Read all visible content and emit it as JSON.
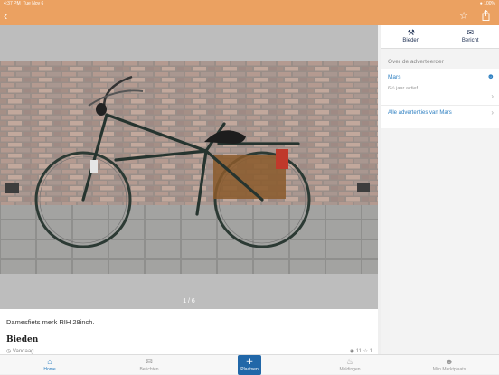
{
  "status": {
    "time": "4:37 PM",
    "date": "Tue Nov 6",
    "battery": "100%"
  },
  "nav": {
    "back_icon": "back-chevron-icon",
    "favorite_icon": "star-icon",
    "share_icon": "share-icon"
  },
  "listing": {
    "photo_counter": "1 / 6",
    "description": "Damesfiets merk RIH 28inch.",
    "bid_heading": "Bieden",
    "date_label": "Vandaag",
    "views": "11",
    "favorites": "1"
  },
  "actions": [
    {
      "label": "Bieden",
      "icon": "auction-hammer-icon"
    },
    {
      "label": "Bericht",
      "icon": "chat-bubbles-icon"
    }
  ],
  "seller": {
    "section_title": "Over de adverteerder",
    "name": "Mars",
    "active_text": "6½ jaar actief",
    "all_ads_label": "Alle advertenties van Mars"
  },
  "tabbar": [
    {
      "label": "Home",
      "icon": "home-icon",
      "active": true
    },
    {
      "label": "Berichten",
      "icon": "chat-icon",
      "active": false
    },
    {
      "label": "Plaatsen",
      "icon": "place-ad-icon",
      "active": false
    },
    {
      "label": "Meldingen",
      "icon": "bell-icon",
      "active": false
    },
    {
      "label": "Mijn Marktplaats",
      "icon": "user-icon",
      "active": false
    }
  ],
  "colors": {
    "header": "#eba161",
    "link": "#2d7fc1",
    "place_button": "#2167a8"
  }
}
